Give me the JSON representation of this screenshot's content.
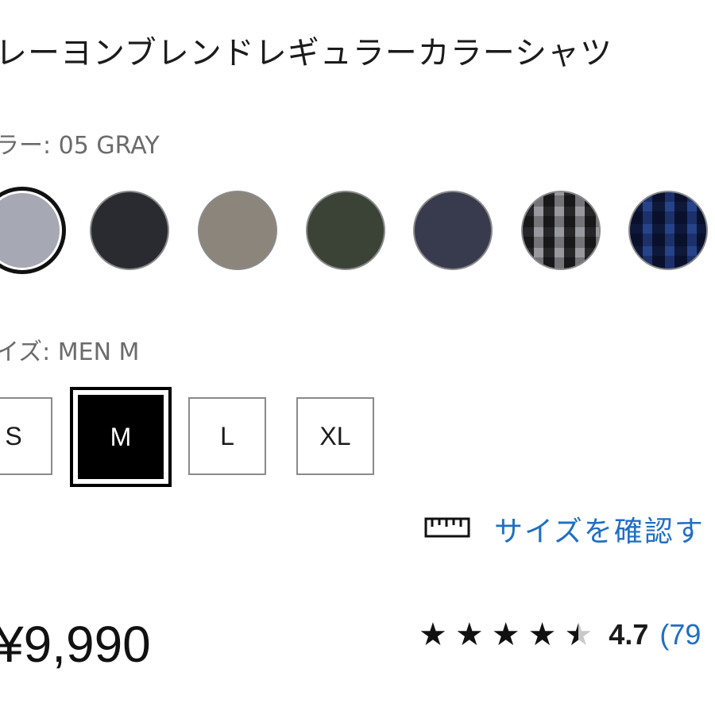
{
  "product": {
    "title": "レーヨンブレンドレギュラーカラーシャツ"
  },
  "color": {
    "label_text": "ラー: 05 GRAY",
    "swatches": [
      {
        "name": "05 GRAY",
        "hex": "#a6a8b4",
        "selected": true
      },
      {
        "name": "dark-charcoal",
        "hex": "#2a2b30",
        "selected": false
      },
      {
        "name": "beige",
        "hex": "#8c857b",
        "selected": false
      },
      {
        "name": "olive",
        "hex": "#3b4336",
        "selected": false
      },
      {
        "name": "navy",
        "hex": "#373b4d",
        "selected": false
      },
      {
        "name": "gray-check",
        "hex": "#5c5d62",
        "selected": false
      },
      {
        "name": "blue-check",
        "hex": "#1f3569",
        "selected": false
      }
    ]
  },
  "size": {
    "label_text": "イズ: MEN M",
    "options": [
      {
        "label": "S",
        "selected": false
      },
      {
        "label": "M",
        "selected": true
      },
      {
        "label": "L",
        "selected": false
      },
      {
        "label": "XL",
        "selected": false
      }
    ]
  },
  "size_guide": {
    "label": "サイズを確認す",
    "icon": "ruler-icon"
  },
  "price": {
    "text": "¥9,990"
  },
  "rating": {
    "stars": 4.5,
    "value": "4.7",
    "count_text": "(79"
  },
  "colors": {
    "accent_link": "#1f6fc4",
    "text": "#1b1b1b",
    "muted": "#6b6b6b",
    "selected_fill": "#000000"
  }
}
